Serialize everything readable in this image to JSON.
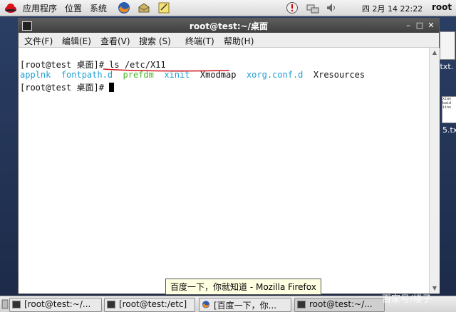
{
  "top_panel": {
    "menus": [
      "应用程序",
      "位置",
      "系统"
    ],
    "clock": "四 2月 14 22:22",
    "user": "root"
  },
  "desktop": {
    "icon_labels": [
      ".txt.",
      "5.tx"
    ],
    "file_preview_lines": [
      "xiao",
      "baid",
      "iino"
    ]
  },
  "window": {
    "title": "root@test:~/桌面",
    "menu": [
      "文件(F)",
      "编辑(E)",
      "查看(V)",
      "搜索 (S)",
      "终端(T)",
      "帮助(H)"
    ]
  },
  "terminal": {
    "prompt": "[root@test 桌面]# ",
    "command": "ls /etc/X11",
    "listing": [
      {
        "name": "applnk",
        "color": "#1f9ed3"
      },
      {
        "name": "fontpath.d",
        "color": "#1f9ed3"
      },
      {
        "name": "prefdm",
        "color": "#4bb52a"
      },
      {
        "name": "xinit",
        "color": "#1f9ed3"
      },
      {
        "name": "Xmodmap",
        "color": "#111111"
      },
      {
        "name": "xorg.conf.d",
        "color": "#1f9ed3"
      },
      {
        "name": "Xresources",
        "color": "#111111"
      }
    ],
    "prompt2": "[root@test 桌面]# "
  },
  "tooltip": "百度一下，你就知道 - Mozilla Firefox",
  "taskbar": {
    "tasks": [
      "[root@test:~/...",
      "[root@test:/etc]",
      "[百度一下，你...",
      "root@test:~/..."
    ]
  },
  "watermark": "百家号/楼子"
}
